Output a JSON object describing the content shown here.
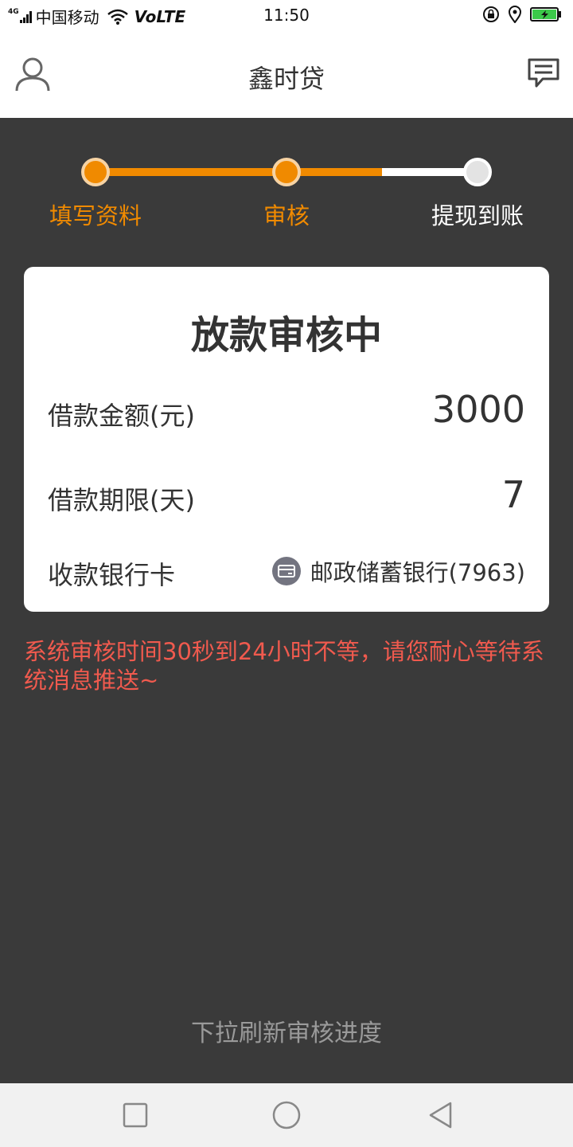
{
  "status_bar": {
    "network_type": "4G",
    "carrier": "中国移动",
    "volte": "VoLTE",
    "time": "11:50",
    "icons": [
      "signal-icon",
      "wifi-icon",
      "orientation-lock-icon",
      "location-icon",
      "battery-charging-icon"
    ]
  },
  "header": {
    "title": "鑫时贷",
    "left_icon": "user-icon",
    "right_icon": "message-icon"
  },
  "progress": {
    "steps": [
      {
        "label": "填写资料",
        "state": "done"
      },
      {
        "label": "审核",
        "state": "active"
      },
      {
        "label": "提现到账",
        "state": "pending"
      }
    ],
    "completed_fraction": 0.75,
    "active_color": "#f08a00",
    "inactive_color": "#ffffff"
  },
  "card": {
    "title": "放款审核中",
    "rows": [
      {
        "label": "借款金额(元)",
        "value": "3000"
      },
      {
        "label": "借款期限(天)",
        "value": "7"
      },
      {
        "label": "收款银行卡",
        "value": "邮政储蓄银行(7963)",
        "icon": "bank-card-icon"
      }
    ]
  },
  "notice": "系统审核时间30秒到24小时不等，请您耐心等待系统消息推送~",
  "pull_hint": "下拉刷新审核进度",
  "nav_bar": {
    "buttons": [
      "recent-apps-icon",
      "home-icon",
      "back-icon"
    ]
  },
  "colors": {
    "accent": "#f08a00",
    "notice": "#f05a4e",
    "background": "#3a3a3a"
  }
}
